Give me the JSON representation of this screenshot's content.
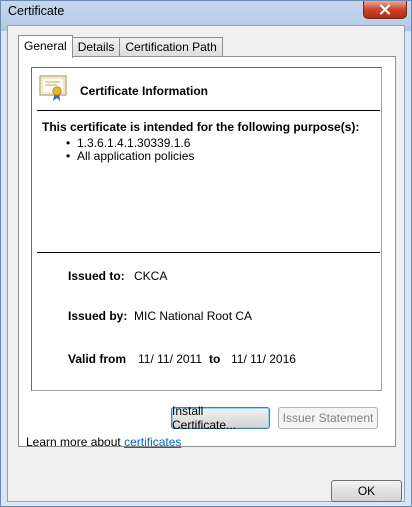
{
  "window": {
    "title": "Certificate"
  },
  "tabs": [
    {
      "label": "General",
      "active": true
    },
    {
      "label": "Details",
      "active": false
    },
    {
      "label": "Certification Path",
      "active": false
    }
  ],
  "general": {
    "info_title": "Certificate Information",
    "purpose_heading": "This certificate is intended for the following purpose(s):",
    "purposes": [
      "1.3.6.1.4.1.30339.1.6",
      "All application policies"
    ],
    "issued_to_label": "Issued to:",
    "issued_to": "CKCA",
    "issued_by_label": "Issued by:",
    "issued_by": "MIC National Root CA",
    "valid_from_label": "Valid from",
    "valid_from": "11/ 11/ 2011",
    "valid_to_label": "to",
    "valid_to": "11/ 11/ 2016",
    "install_button": "Install Certificate...",
    "issuer_statement_button": "Issuer Statement"
  },
  "footer": {
    "learn_prefix": "Learn more about ",
    "learn_link": "certificates",
    "ok_button": "OK"
  },
  "colors": {
    "link": "#0066cc",
    "close_button": "#c9452a",
    "disabled_text": "#838383"
  }
}
